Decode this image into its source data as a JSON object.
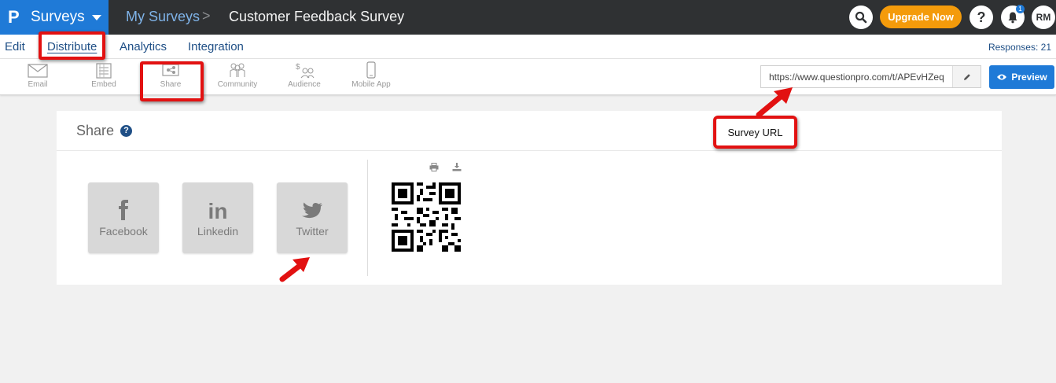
{
  "header": {
    "app_name": "Surveys",
    "breadcrumb_parent": "My Surveys",
    "breadcrumb_separator": ">",
    "survey_title": "Customer Feedback Survey",
    "upgrade_label": "Upgrade Now",
    "help_label": "?",
    "notification_count": "1",
    "avatar_initials": "RM",
    "brand_color": "#1f7ad7",
    "upgrade_color": "#f49b0b"
  },
  "subnav": {
    "tabs": [
      "Edit",
      "Distribute",
      "Analytics",
      "Integration"
    ],
    "active_tab": "Distribute",
    "responses_label": "Responses: 21"
  },
  "toolbar": {
    "items": [
      {
        "label": "Email",
        "icon": "envelope-icon"
      },
      {
        "label": "Embed",
        "icon": "embed-icon"
      },
      {
        "label": "Share",
        "icon": "share-icon"
      },
      {
        "label": "Community",
        "icon": "community-icon"
      },
      {
        "label": "Audience",
        "icon": "audience-icon"
      },
      {
        "label": "Mobile App",
        "icon": "mobile-icon"
      }
    ],
    "active_item": "Share",
    "survey_url": "https://www.questionpro.com/t/APEvHZeq",
    "preview_label": "Preview"
  },
  "share_panel": {
    "title": "Share",
    "help_label": "?",
    "social": [
      {
        "name": "Facebook",
        "icon": "facebook-icon"
      },
      {
        "name": "Linkedin",
        "icon": "linkedin-icon"
      },
      {
        "name": "Twitter",
        "icon": "twitter-icon"
      }
    ],
    "qr_icons": [
      "print-icon",
      "download-icon"
    ]
  },
  "annotations": {
    "callout_text": "Survey URL",
    "highlight_color": "#e21111"
  }
}
